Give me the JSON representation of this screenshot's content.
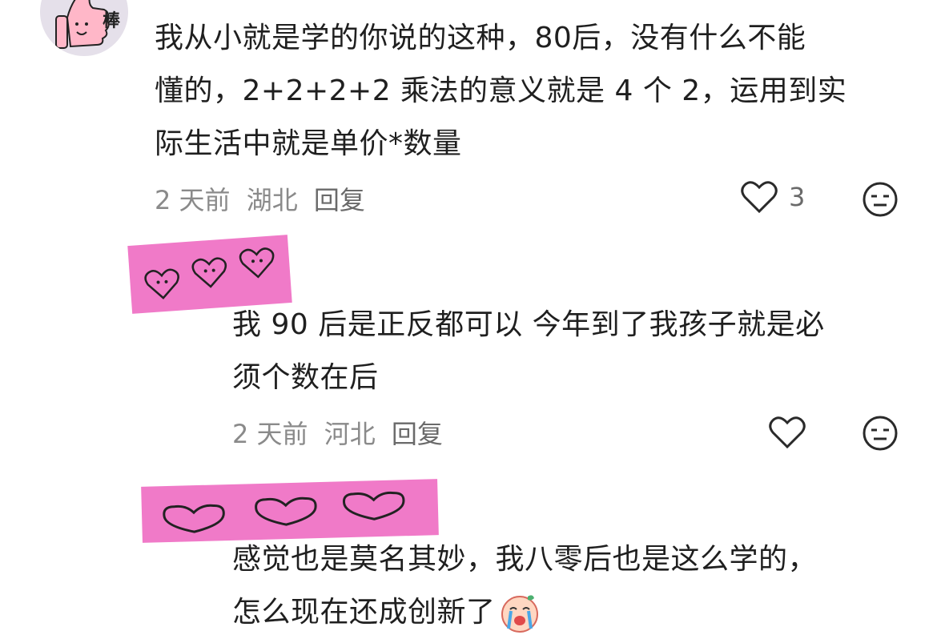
{
  "comments": [
    {
      "lines": [
        "我从小就是学的你说的这种，80后，没有什么不能",
        "懂的，2+2+2+2 乘法的意义就是 4 个 2，运用到实",
        "际生活中就是单价*数量"
      ],
      "time": "2 天前",
      "region": "湖北",
      "reply": "回复",
      "likes": "3"
    },
    {
      "lines": [
        "我 90 后是正反都可以  今年到了我孩子就是必",
        "须个数在后"
      ],
      "time": "2 天前",
      "region": "河北",
      "reply": "回复",
      "likes": ""
    },
    {
      "lines": [
        "感觉也是莫名其妙，我八零后也是这么学的，",
        "怎么现在还成创新了"
      ],
      "time": "",
      "region": "",
      "reply": "",
      "likes": ""
    }
  ],
  "avatar_sticker_text": "棒",
  "colors": {
    "text": "#1f1f1f",
    "meta": "#8a8a8a",
    "sticker_pink": "#f07ac8"
  },
  "icons": [
    "heart-icon",
    "meh-face-icon",
    "crying-emoji-icon"
  ]
}
